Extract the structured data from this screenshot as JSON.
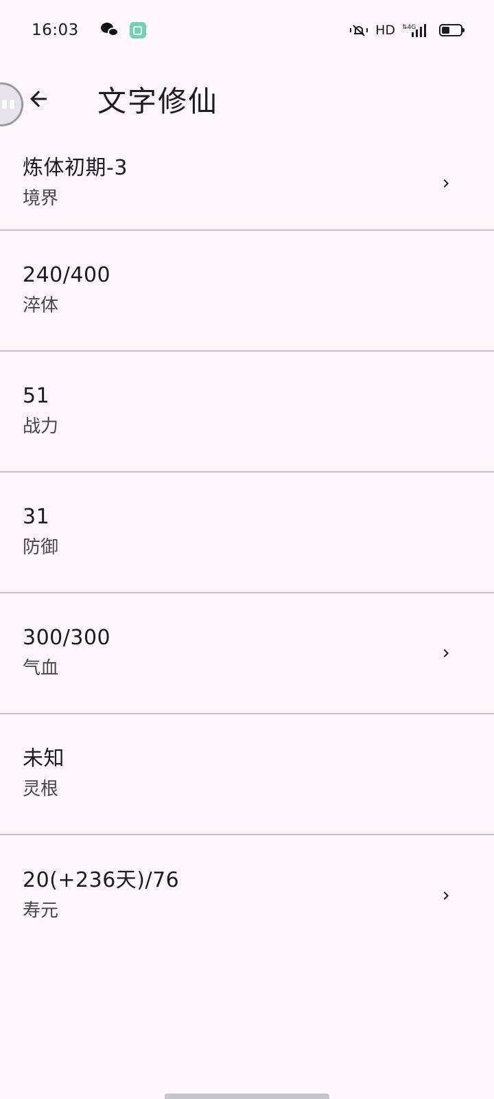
{
  "status_bar": {
    "time": "16:03",
    "network_label": "HD",
    "icons": [
      "wechat-icon",
      "app-badge-icon",
      "mute-icon",
      "signal-4g-icon",
      "battery-icon"
    ]
  },
  "app_bar": {
    "back_icon": "arrow-back-icon",
    "title": "文字修仙"
  },
  "items": [
    {
      "value": "炼体初期-3",
      "label": "境界",
      "has_chevron": true
    },
    {
      "value": "240/400",
      "label": "淬体",
      "has_chevron": false
    },
    {
      "value": "51",
      "label": "战力",
      "has_chevron": false
    },
    {
      "value": "31",
      "label": "防御",
      "has_chevron": false
    },
    {
      "value": "300/300",
      "label": "气血",
      "has_chevron": true
    },
    {
      "value": "未知",
      "label": "灵根",
      "has_chevron": false
    },
    {
      "value": "20(+236天)/76",
      "label": "寿元",
      "has_chevron": true
    }
  ],
  "colors": {
    "background": "#fdf7fb",
    "divider": "#cac4d0",
    "primary_text": "#1c1b1f",
    "secondary_text": "#49454f",
    "app_badge": "#6fd3b3"
  }
}
